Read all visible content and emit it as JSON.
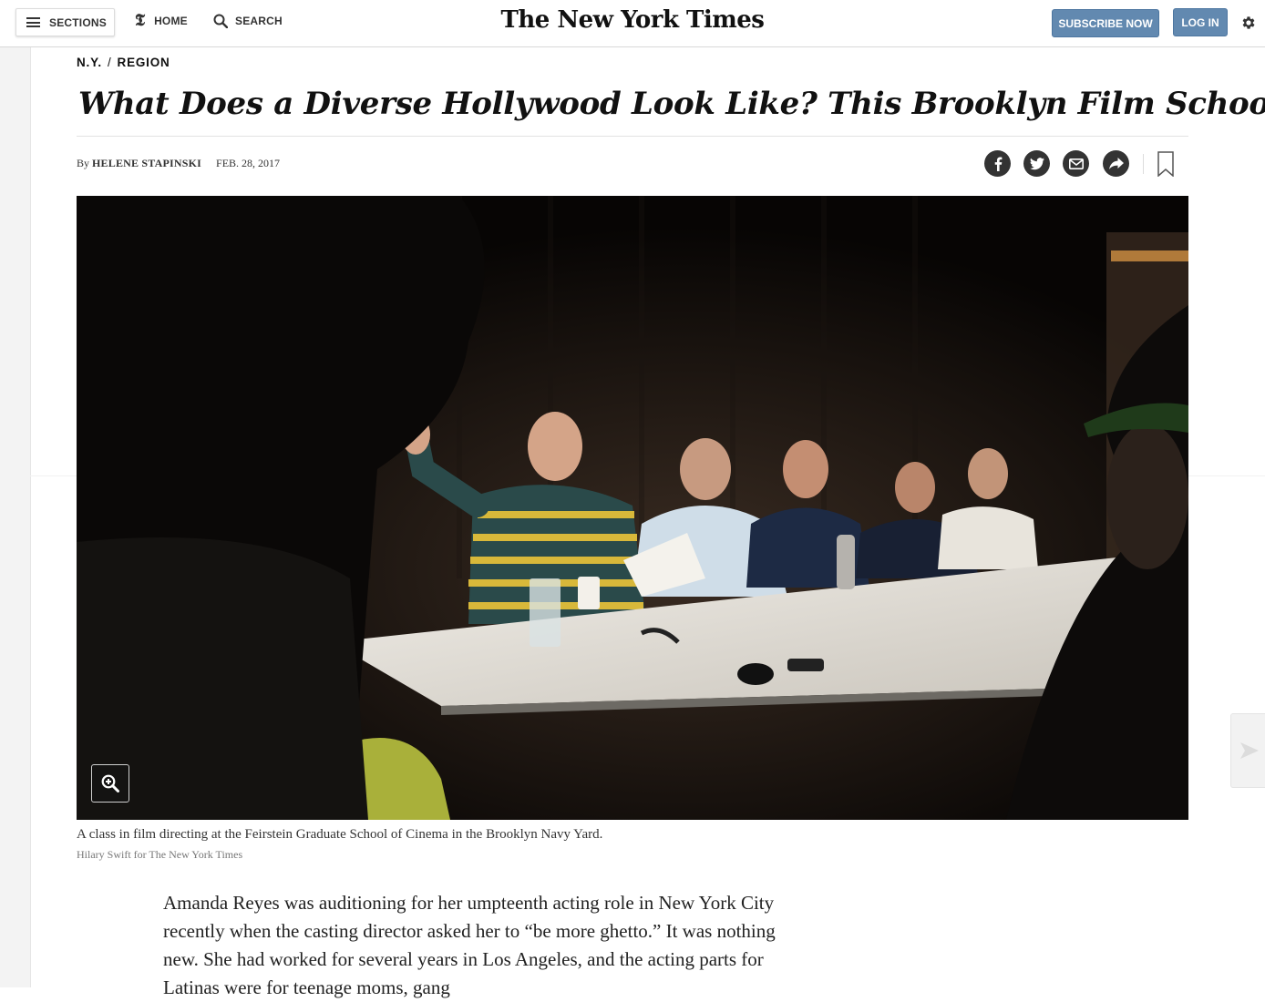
{
  "masthead": {
    "sections_label": "SECTIONS",
    "home_label": "HOME",
    "search_label": "SEARCH",
    "logo_text": "The New York Times",
    "subscribe_label": "SUBSCRIBE NOW",
    "login_label": "LOG IN",
    "accent_color": "#6289b0"
  },
  "article": {
    "kicker": {
      "section": "N.Y.",
      "subsection": "REGION"
    },
    "headline": "What Does a Diverse Hollywood Look Like? This Brooklyn Film School",
    "byline_prefix": "By",
    "author": "HELENE STAPINSKI",
    "date": "FEB. 28, 2017",
    "share_icons": [
      "facebook-icon",
      "twitter-icon",
      "email-icon",
      "share-arrow-icon",
      "bookmark-icon"
    ],
    "photo": {
      "caption": "A class in film directing at the Feirstein Graduate School of Cinema in the Brooklyn Navy Yard.",
      "credit": "Hilary Swift for The New York Times"
    },
    "body_text": "Amanda Reyes was auditioning for her umpteenth acting role in New York City recently when the casting director asked her to “be more ghetto.” It was nothing new. She had worked for several years in Los Angeles, and the acting parts for Latinas were for teenage moms, gang"
  }
}
